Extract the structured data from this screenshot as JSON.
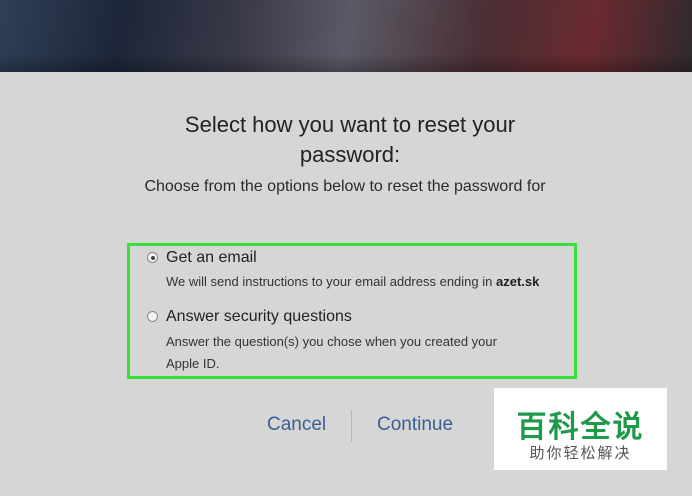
{
  "heading": {
    "title_line1": "Select how you want to reset your",
    "title_line2": "password:",
    "subtitle": "Choose from the options below to reset the password for"
  },
  "options": [
    {
      "label": "Get an email",
      "desc_prefix": "We will send instructions to your email address ending in ",
      "desc_bold": "azet.sk",
      "checked": true
    },
    {
      "label": "Answer security questions",
      "desc_line1": "Answer the question(s) you chose when you created your",
      "desc_line2": "Apple ID.",
      "checked": false
    }
  ],
  "buttons": {
    "cancel": "Cancel",
    "continue": "Continue"
  },
  "watermark": {
    "main": "百科全说",
    "sub": "助你轻松解决"
  },
  "colors": {
    "highlight_border": "#39e039",
    "button_text": "#3a5f92",
    "watermark_green": "#1f9a4a"
  }
}
